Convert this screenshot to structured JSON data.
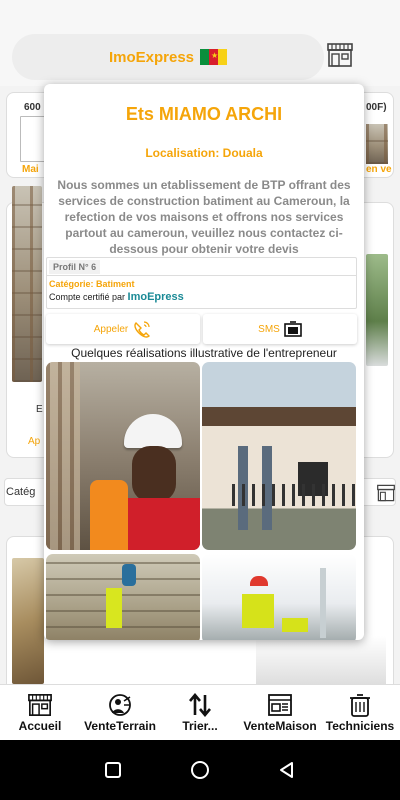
{
  "header": {
    "title": "ImoExpress",
    "flag_colors": [
      "#0a8f3c",
      "#d81e2c",
      "#f7d117"
    ]
  },
  "background_page": {
    "left_card_label": "Mai",
    "top_left_price": "600",
    "top_right_price": "00F)",
    "right_card_label": "en ve",
    "mid_left_E": "E",
    "mid_left_Ap": "Ap",
    "category_label": "Catég"
  },
  "dialog": {
    "title": "Ets MIAMO ARCHI",
    "location": "Localisation: Douala",
    "description": "Nous sommes un etablissement de BTP offrant des services de construction batiment au Cameroun, la refection de vos maisons et offrons nos services partout au cameroun, veuillez nous contactez ci-dessous pour obtenir votre devis",
    "profil": "Profil N° 6",
    "category": "Catégorie: Batiment",
    "certified_prefix": "Compte certifié par ",
    "certified_brand": "ImoEpress",
    "call_label": "Appeler",
    "sms_label": "SMS",
    "gallery_title": "Quelques réalisations illustrative de l'entrepreneur"
  },
  "bottom_nav": [
    {
      "label": "Accueil",
      "icon": "shop-icon"
    },
    {
      "label": "VenteTerrain",
      "icon": "land-sale-icon"
    },
    {
      "label": "Trier...",
      "icon": "sort-icon"
    },
    {
      "label": "VenteMaison",
      "icon": "house-sale-icon"
    },
    {
      "label": "Techniciens",
      "icon": "technicians-icon"
    }
  ],
  "colors": {
    "accent": "#f5a50a",
    "brand_teal": "#1a8a96"
  }
}
